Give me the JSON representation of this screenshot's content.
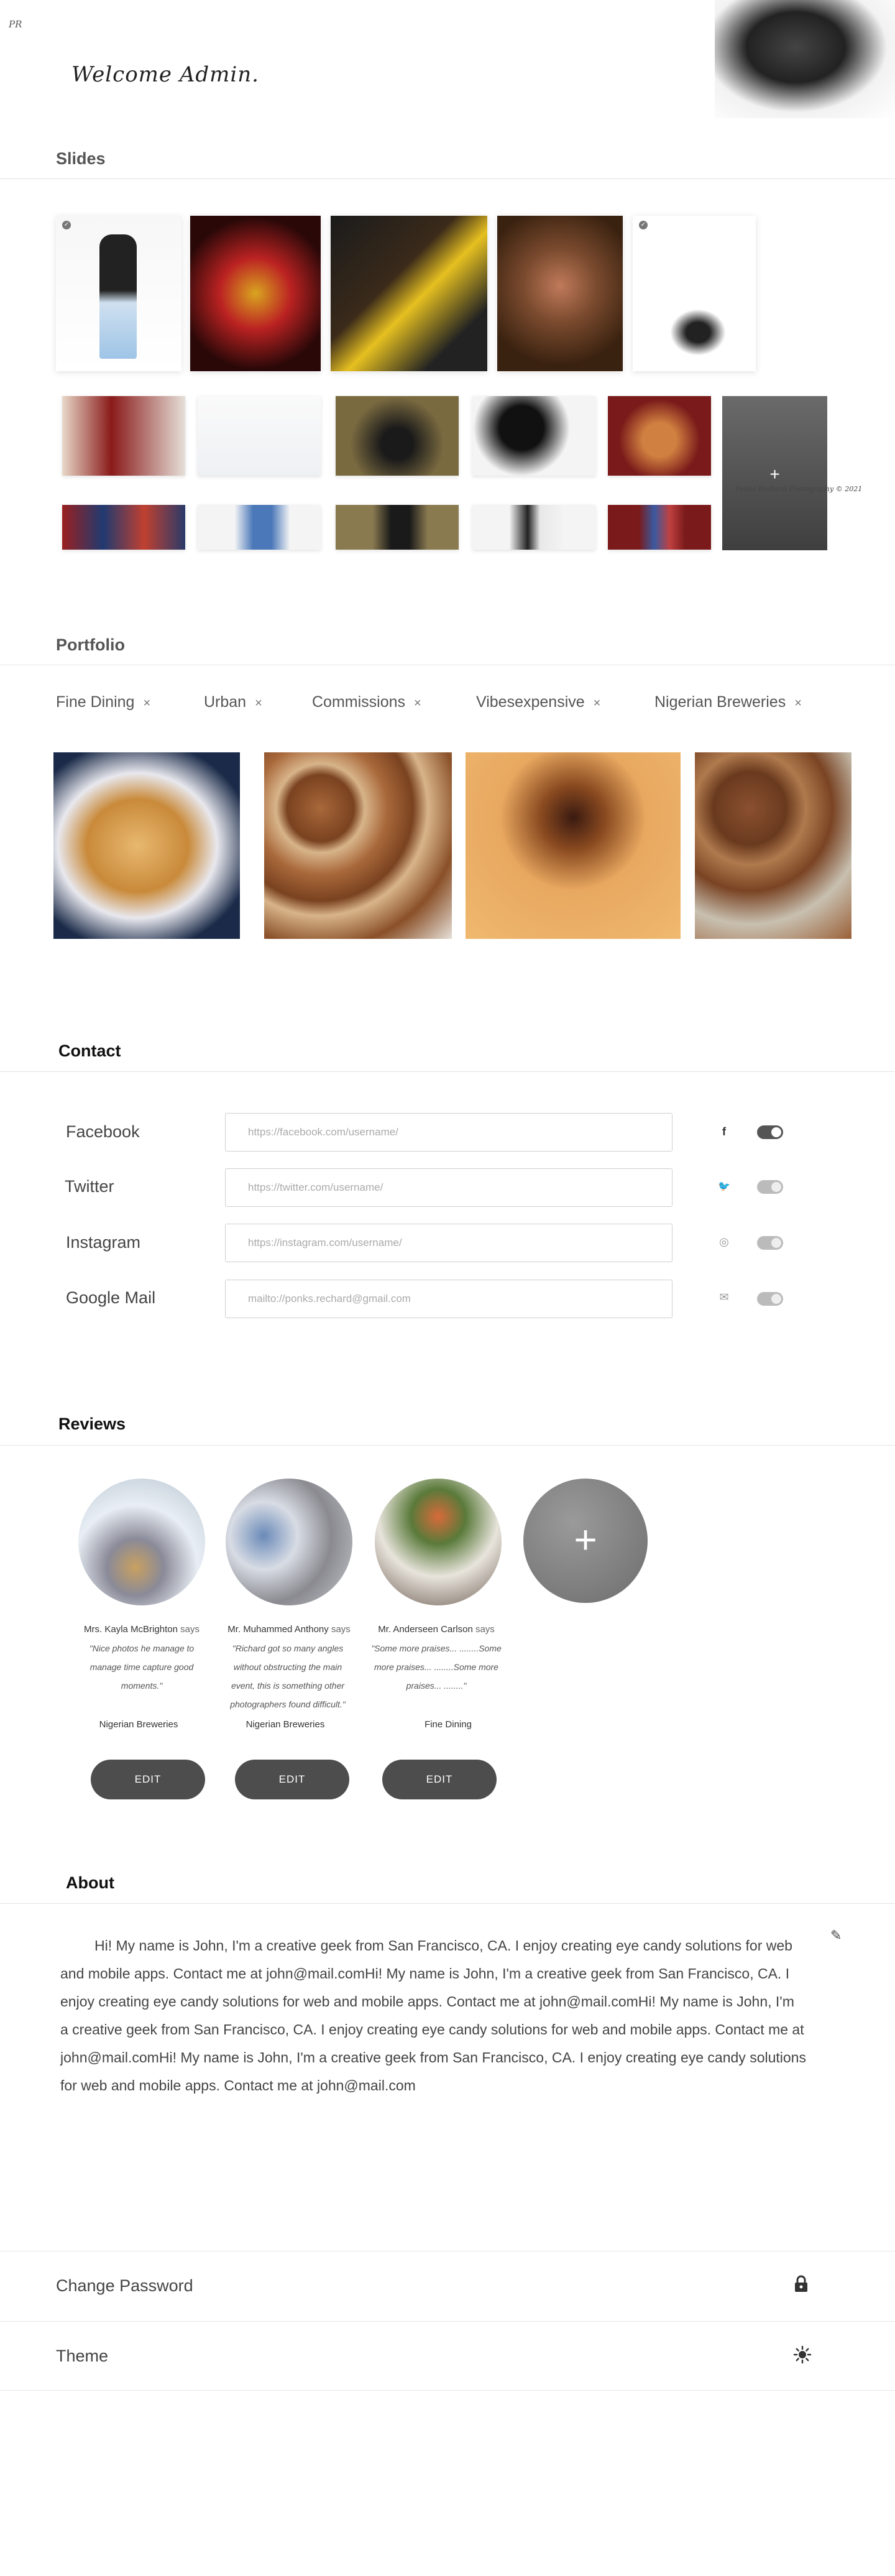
{
  "header": {
    "logo": "PR",
    "welcome": "Welcome Admin."
  },
  "slides": {
    "title": "Slides",
    "add_icon": "plus-icon",
    "signature": "Ponks Rechard Photography © 2021"
  },
  "portfolio": {
    "title": "Portfolio",
    "tags": [
      {
        "label": "Fine Dining",
        "remove": "×"
      },
      {
        "label": "Urban",
        "remove": "×"
      },
      {
        "label": "Commissions",
        "remove": "×"
      },
      {
        "label": "Vibesexpensive",
        "remove": "×"
      },
      {
        "label": "Nigerian Breweries",
        "remove": "×"
      }
    ]
  },
  "contact": {
    "title": "Contact",
    "rows": [
      {
        "label": "Facebook",
        "placeholder": "https://facebook.com/username/",
        "icon": "facebook-icon",
        "glyph": "f",
        "enabled": true
      },
      {
        "label": "Twitter",
        "placeholder": "https://twitter.com/username/",
        "icon": "twitter-icon",
        "glyph": "🐦",
        "enabled": false
      },
      {
        "label": "Instagram",
        "placeholder": "https://instagram.com/username/",
        "icon": "instagram-icon",
        "glyph": "◎",
        "enabled": false
      },
      {
        "label": "Google Mail",
        "placeholder": "mailto://ponks.rechard@gmail.com",
        "icon": "mail-icon",
        "glyph": "✉",
        "enabled": false
      }
    ]
  },
  "reviews": {
    "title": "Reviews",
    "says": "says",
    "edit_label": "EDIT",
    "add_icon": "+",
    "items": [
      {
        "name": "Mrs. Kayla McBrighton",
        "quote": "\"Nice photos he manage to manage time capture good moments.\"",
        "org": "Nigerian Breweries"
      },
      {
        "name": "Mr. Muhammed Anthony",
        "quote": "\"Richard got so many angles without obstructing the main event, this is something other photographers found difficult.\"",
        "org": "Nigerian Breweries"
      },
      {
        "name": "Mr. Anderseen Carlson",
        "quote": "\"Some more praises... ........Some more praises... ........Some more praises... ........\"",
        "org": "Fine Dining"
      }
    ]
  },
  "about": {
    "title": "About",
    "text": "Hi! My name is John, I'm a creative geek from San Francisco, CA. I enjoy creating eye candy solutions for web and mobile apps. Contact me at john@mail.comHi! My name is John, I'm a creative geek from San Francisco, CA. I enjoy creating eye candy solutions for web and mobile apps. Contact me at john@mail.comHi! My name is John, I'm a creative geek from San Francisco, CA. I enjoy creating eye candy solutions for web and mobile apps. Contact me at john@mail.comHi! My name is John, I'm a creative geek from San Francisco, CA. I enjoy creating eye candy solutions for web and mobile apps. Contact me at john@mail.com"
  },
  "settings": {
    "change_password": "Change Password",
    "theme": "Theme"
  }
}
